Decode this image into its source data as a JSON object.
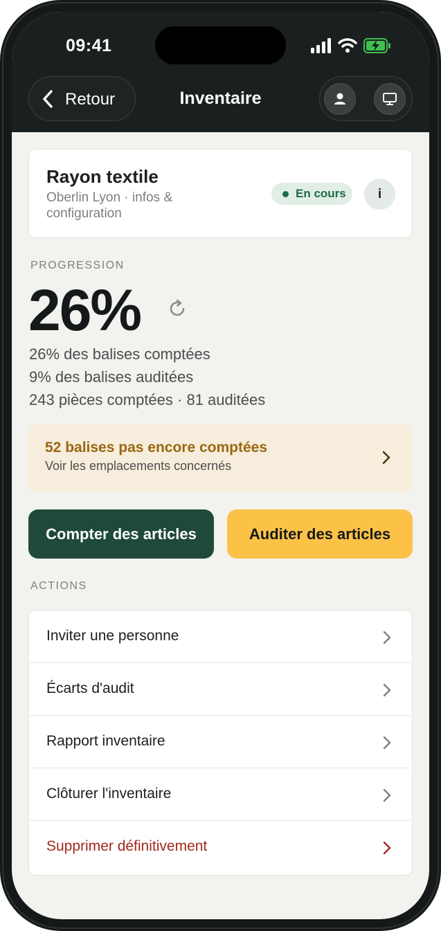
{
  "status_bar": {
    "time": "09:41"
  },
  "header": {
    "back_label": "Retour",
    "title": "Inventaire"
  },
  "inventory": {
    "name": "Rayon textile",
    "subtitle": "Oberlin Lyon · infos & configuration",
    "status": "En cours",
    "info_label": "i"
  },
  "progress": {
    "section_label": "PROGRESSION",
    "percent": "26%",
    "stats": [
      "26% des balises comptées",
      "9% des balises auditées",
      "243 pièces comptées · 81 auditées"
    ]
  },
  "alert": {
    "title": "52 balises pas encore comptées",
    "subtitle": "Voir les emplacements concernés"
  },
  "buttons": {
    "count": "Compter des articles",
    "audit": "Auditer des articles"
  },
  "actions": {
    "section_label": "ACTIONS",
    "items": [
      {
        "label": "Inviter une personne"
      },
      {
        "label": "Écarts d'audit"
      },
      {
        "label": "Rapport inventaire"
      },
      {
        "label": "Clôturer l'inventaire"
      },
      {
        "label": "Supprimer définitivement"
      }
    ]
  },
  "colors": {
    "header_bg": "#1a1f1f",
    "accent_green": "#1f4a3a",
    "accent_yellow": "#fcc247",
    "status_green": "#1f6c45",
    "alert_text": "#9a6713",
    "danger": "#a3281c"
  },
  "icons": [
    "signal-icon",
    "wifi-icon",
    "battery-charging-icon",
    "chevron-left-icon",
    "person-icon",
    "monitor-icon",
    "refresh-icon",
    "chevron-right-icon"
  ]
}
